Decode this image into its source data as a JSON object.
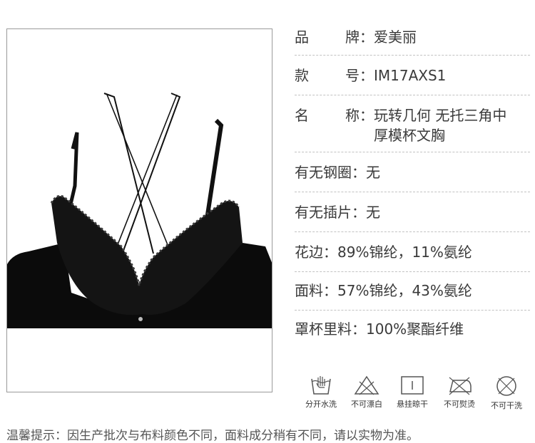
{
  "specs": [
    {
      "label": "品 牌",
      "label_chars": [
        "品",
        "牌"
      ],
      "colon": "：",
      "value": "爱美丽"
    },
    {
      "label": "款 号",
      "label_chars": [
        "款",
        "号"
      ],
      "colon": "：",
      "value": "IM17AXS1"
    },
    {
      "label": "名 称",
      "label_chars": [
        "名",
        "称"
      ],
      "colon": "：",
      "value": "玩转几何 无托三角中厚模杯文胸"
    },
    {
      "label": "有无钢圈",
      "colon": "：",
      "value": "无"
    },
    {
      "label": "有无插片",
      "colon": "：",
      "value": "无"
    },
    {
      "label": "花边",
      "colon": "：",
      "value": "89%锦纶，11%氨纶"
    },
    {
      "label": "面料",
      "colon": "：",
      "value": "57%锦纶，43%氨纶"
    },
    {
      "label": "罩杯里料",
      "colon": "：",
      "value": "100%聚酯纤维"
    }
  ],
  "care": [
    {
      "icon": "hand-wash-icon",
      "label": "分开水洗"
    },
    {
      "icon": "no-bleach-icon",
      "label": "不可漂白"
    },
    {
      "icon": "hang-dry-icon",
      "label": "悬挂晾干"
    },
    {
      "icon": "no-iron-icon",
      "label": "不可熨烫"
    },
    {
      "icon": "no-dry-clean-icon",
      "label": "不可干洗"
    }
  ],
  "tip": "温馨提示：因生产批次与布料颜色不同，面料成分稍有不同，请以实物为准。"
}
